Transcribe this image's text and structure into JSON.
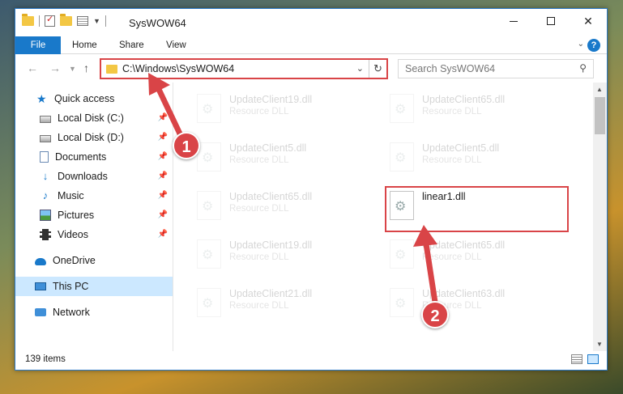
{
  "window": {
    "title": "SysWOW64",
    "colors": {
      "accent": "#1979ca",
      "annotation": "#d94447",
      "selected": "#cce8ff"
    }
  },
  "ribbon": {
    "tabs": [
      {
        "label": "File"
      },
      {
        "label": "Home"
      },
      {
        "label": "Share"
      },
      {
        "label": "View"
      }
    ],
    "help_glyph": "?"
  },
  "address_bar": {
    "path": "C:\\Windows\\SysWOW64"
  },
  "search": {
    "placeholder": "Search SysWOW64"
  },
  "sidebar": {
    "items": [
      {
        "label": "Quick access",
        "icon": "quick-access-star-icon",
        "pinned": false
      },
      {
        "label": "Local Disk (C:)",
        "icon": "local-disk-icon",
        "pinned": true
      },
      {
        "label": "Local Disk (D:)",
        "icon": "local-disk-icon",
        "pinned": true
      },
      {
        "label": "Documents",
        "icon": "documents-icon",
        "pinned": true
      },
      {
        "label": "Downloads",
        "icon": "downloads-icon",
        "pinned": true
      },
      {
        "label": "Music",
        "icon": "music-icon",
        "pinned": true
      },
      {
        "label": "Pictures",
        "icon": "pictures-icon",
        "pinned": true
      },
      {
        "label": "Videos",
        "icon": "videos-icon",
        "pinned": true
      },
      {
        "label": "OneDrive",
        "icon": "onedrive-icon",
        "pinned": false
      },
      {
        "label": "This PC",
        "icon": "this-pc-icon",
        "pinned": false,
        "selected": true
      },
      {
        "label": "Network",
        "icon": "network-icon",
        "pinned": false
      }
    ]
  },
  "files": [
    {
      "name": "UpdateClient19.dll",
      "type": "Resource DLL",
      "faded": true
    },
    {
      "name": "UpdateClient65.dll",
      "type": "Resource DLL",
      "faded": true
    },
    {
      "name": "UpdateClient5.dll",
      "type": "Resource DLL",
      "faded": true
    },
    {
      "name": "UpdateClient5.dll",
      "type": "Resource DLL",
      "faded": true
    },
    {
      "name": "UpdateClient65.dll",
      "type": "Resource DLL",
      "faded": true
    },
    {
      "name": "linear1.dll",
      "type": "",
      "faded": false
    },
    {
      "name": "UpdateClient19.dll",
      "type": "Resource DLL",
      "faded": true
    },
    {
      "name": "UpdateClient65.dll",
      "type": "Resource DLL",
      "faded": true
    },
    {
      "name": "UpdateClient21.dll",
      "type": "Resource DLL",
      "faded": true
    },
    {
      "name": "UpdateClient63.dll",
      "type": "Resource DLL",
      "faded": true
    }
  ],
  "status": {
    "item_count": "139 items"
  },
  "annotations": {
    "step1": "1",
    "step2": "2"
  }
}
